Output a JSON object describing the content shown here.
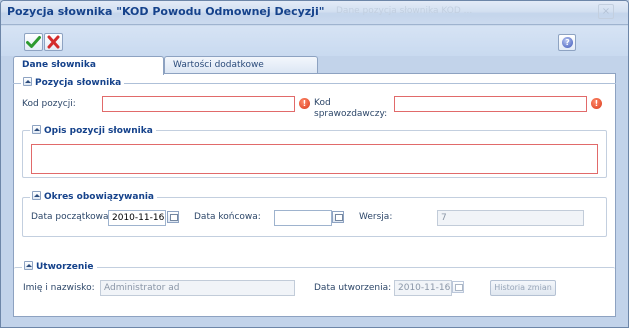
{
  "window": {
    "title": "Pozycja słownika \"KOD Powodu Odmownej Decyzji\"",
    "ghost_text": "Dane pozycja słownika  KOD  ...",
    "close_label": "×"
  },
  "toolbar": {
    "ok_icon": "check-icon",
    "cancel_icon": "x-icon",
    "help_label": "?"
  },
  "tabs": [
    {
      "label": "Dane słownika",
      "active": true
    },
    {
      "label": "Wartości dodatkowe",
      "active": false
    }
  ],
  "groups": {
    "pozycja": {
      "title": "Pozycja słownika",
      "kod_pozycji_label": "Kod pozycji:",
      "kod_pozycji_value": "",
      "kod_spraw_label_1": "Kod",
      "kod_spraw_label_2": "sprawozdawczy:",
      "kod_spraw_value": "",
      "error_glyph": "!"
    },
    "opis": {
      "title": "Opis pozycji słownika",
      "value": ""
    },
    "okres": {
      "title": "Okres obowiązywania",
      "start_label": "Data początkowa:",
      "start_value": "2010-11-16",
      "end_label": "Data końcowa:",
      "end_value": "",
      "version_label": "Wersja:",
      "version_value": "7"
    },
    "utworzenie": {
      "title": "Utworzenie",
      "name_label": "Imię i nazwisko:",
      "name_value": "Administrator ad",
      "date_label": "Data utworzenia:",
      "date_value": "2010-11-16",
      "history_button": "Historia zmian"
    }
  },
  "colors": {
    "error_border": "#e16a6a",
    "title_text": "#15428b",
    "ok_green": "#2e9a2e",
    "cancel_red": "#d42c2c"
  }
}
